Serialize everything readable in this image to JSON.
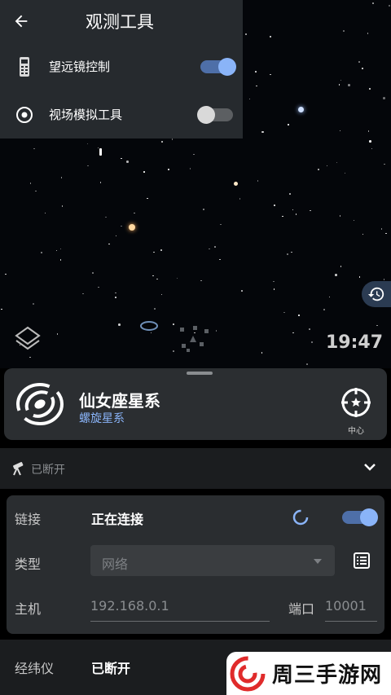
{
  "panel": {
    "title": "观测工具",
    "items": [
      {
        "label": "望远镜控制",
        "toggle_on": true,
        "icon": "telescope-remote-icon"
      },
      {
        "label": "视场模拟工具",
        "toggle_on": false,
        "icon": "target-circle-icon"
      }
    ]
  },
  "sky": {
    "clock": "19:47"
  },
  "object": {
    "name": "仙女座星系",
    "type": "螺旋星系",
    "center_label": "中心"
  },
  "telescope": {
    "status": "已断开"
  },
  "connection": {
    "link_label": "链接",
    "link_state": "正在连接",
    "link_toggle_on": true,
    "type_label": "类型",
    "type_value": "网络",
    "host_label": "主机",
    "host_placeholder": "192.168.0.1",
    "port_label": "端口",
    "port_placeholder": "10001"
  },
  "mount": {
    "label": "经纬仪",
    "value": "已断开"
  },
  "watermark": {
    "text": "周三手游网"
  },
  "colors": {
    "accent": "#8ab4f8",
    "panel": "#262a2e",
    "card": "#2a2d30"
  }
}
